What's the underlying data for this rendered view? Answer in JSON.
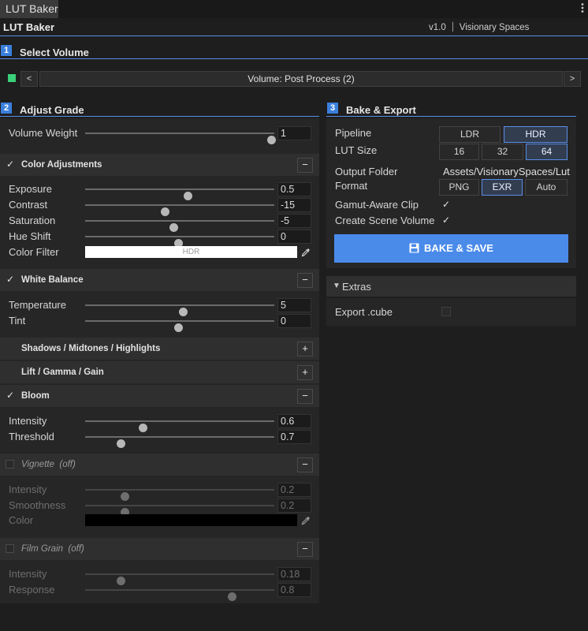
{
  "tab": {
    "label": "LUT Baker",
    "menu_icon": "kebab-icon"
  },
  "header": {
    "title": "LUT Baker",
    "version": "v1.0",
    "vendor": "Visionary Spaces"
  },
  "sections": {
    "select_volume": {
      "num": "1",
      "title": "Select Volume"
    },
    "adjust_grade": {
      "num": "2",
      "title": "Adjust Grade"
    },
    "bake_export": {
      "num": "3",
      "title": "Bake & Export"
    }
  },
  "volume": {
    "prev": "<",
    "next": ">",
    "label": "Volume: Post Process (2)",
    "status_color": "#3ad07a"
  },
  "volume_weight": {
    "label": "Volume Weight",
    "value": "1",
    "fraction": 1.0
  },
  "color_adjustments": {
    "title": "Color Adjustments",
    "toggle": "−",
    "enabled": true,
    "rows": [
      {
        "label": "Exposure",
        "value": "0.5",
        "fraction": 0.55
      },
      {
        "label": "Contrast",
        "value": "-15",
        "fraction": 0.43
      },
      {
        "label": "Saturation",
        "value": "-5",
        "fraction": 0.475
      },
      {
        "label": "Hue Shift",
        "value": "0",
        "fraction": 0.5
      }
    ],
    "color_filter": {
      "label": "Color Filter",
      "value": "HDR",
      "color": "#ffffff"
    }
  },
  "white_balance": {
    "title": "White Balance",
    "toggle": "−",
    "enabled": true,
    "rows": [
      {
        "label": "Temperature",
        "value": "5",
        "fraction": 0.525
      },
      {
        "label": "Tint",
        "value": "0",
        "fraction": 0.5
      }
    ]
  },
  "shadows": {
    "title": "Shadows / Midtones / Highlights",
    "toggle": "+"
  },
  "lift": {
    "title": "Lift / Gamma / Gain",
    "toggle": "+"
  },
  "bloom": {
    "title": "Bloom",
    "toggle": "−",
    "enabled": true,
    "rows": [
      {
        "label": "Intensity",
        "value": "0.6",
        "fraction": 0.31
      },
      {
        "label": "Threshold",
        "value": "0.7",
        "fraction": 0.19
      }
    ]
  },
  "vignette": {
    "title": "Vignette",
    "off": "(off)",
    "toggle": "−",
    "enabled": false,
    "rows": [
      {
        "label": "Intensity",
        "value": "0.2",
        "fraction": 0.21
      },
      {
        "label": "Smoothness",
        "value": "0.2",
        "fraction": 0.21
      }
    ],
    "color": {
      "label": "Color",
      "color": "#000000"
    }
  },
  "film_grain": {
    "title": "Film Grain",
    "off": "(off)",
    "toggle": "−",
    "enabled": false,
    "rows": [
      {
        "label": "Intensity",
        "value": "0.18",
        "fraction": 0.19
      },
      {
        "label": "Response",
        "value": "0.8",
        "fraction": 0.79
      }
    ]
  },
  "bake": {
    "pipeline": {
      "label": "Pipeline",
      "options": [
        "LDR",
        "HDR"
      ],
      "selected": "HDR"
    },
    "lut_size": {
      "label": "LUT Size",
      "options": [
        "16",
        "32",
        "64"
      ],
      "selected": "64"
    },
    "output_folder": {
      "label": "Output Folder",
      "value": "Assets/VisionarySpaces/Lut"
    },
    "format": {
      "label": "Format",
      "options": [
        "PNG",
        "EXR",
        "Auto"
      ],
      "selected": "EXR"
    },
    "gamut_aware": {
      "label": "Gamut-Aware Clip",
      "checked": true
    },
    "scene_volume": {
      "label": "Create Scene Volume",
      "checked": true
    },
    "button_label": "BAKE & SAVE",
    "accent": "#4a8bea"
  },
  "extras": {
    "title": "Extras",
    "export_cube": {
      "label": "Export .cube",
      "checked": false
    }
  }
}
